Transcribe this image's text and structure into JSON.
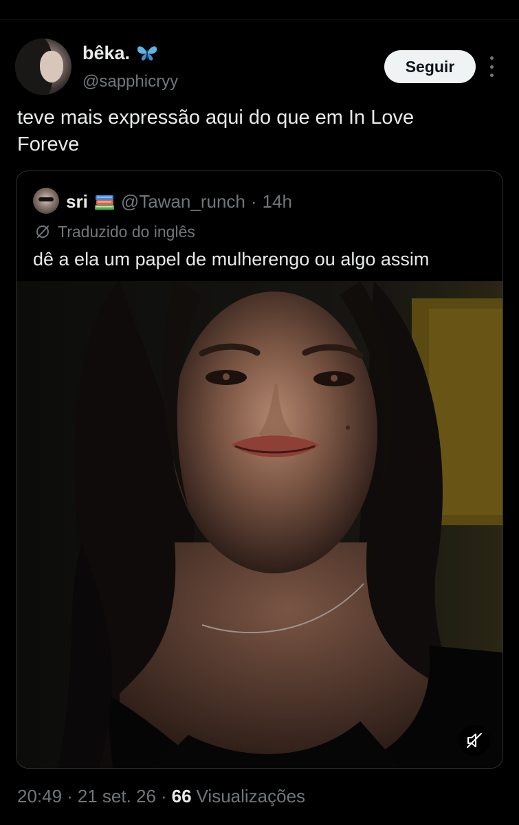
{
  "tweet": {
    "author_name": "bêka.",
    "author_handle": "@sapphicryy",
    "follow_label": "Seguir",
    "text": "teve mais expressão aqui do que em In Love\nForeve"
  },
  "quote": {
    "author_name": "sri",
    "author_handle": "@Tawan_runch",
    "separator": "·",
    "time": "14h",
    "translated_label": "Traduzido do inglês",
    "text": "dê a ela um papel de mulherengo ou algo assim"
  },
  "meta": {
    "time": "20:49",
    "sep1": "·",
    "date": "21 set. 26",
    "sep2": "·",
    "views_count": "66",
    "views_label": "Visualizações"
  },
  "icons": {
    "author_badge": "butterfly-emoji",
    "quote_badge": "books-emoji",
    "translate": "translate-icon",
    "more": "more-vertical-icon",
    "mute": "volume-muted-icon"
  },
  "colors": {
    "background": "#000000",
    "text_primary": "#e7e9ea",
    "text_secondary": "#71767b",
    "follow_bg": "#eff3f4",
    "border": "#2f3336"
  }
}
